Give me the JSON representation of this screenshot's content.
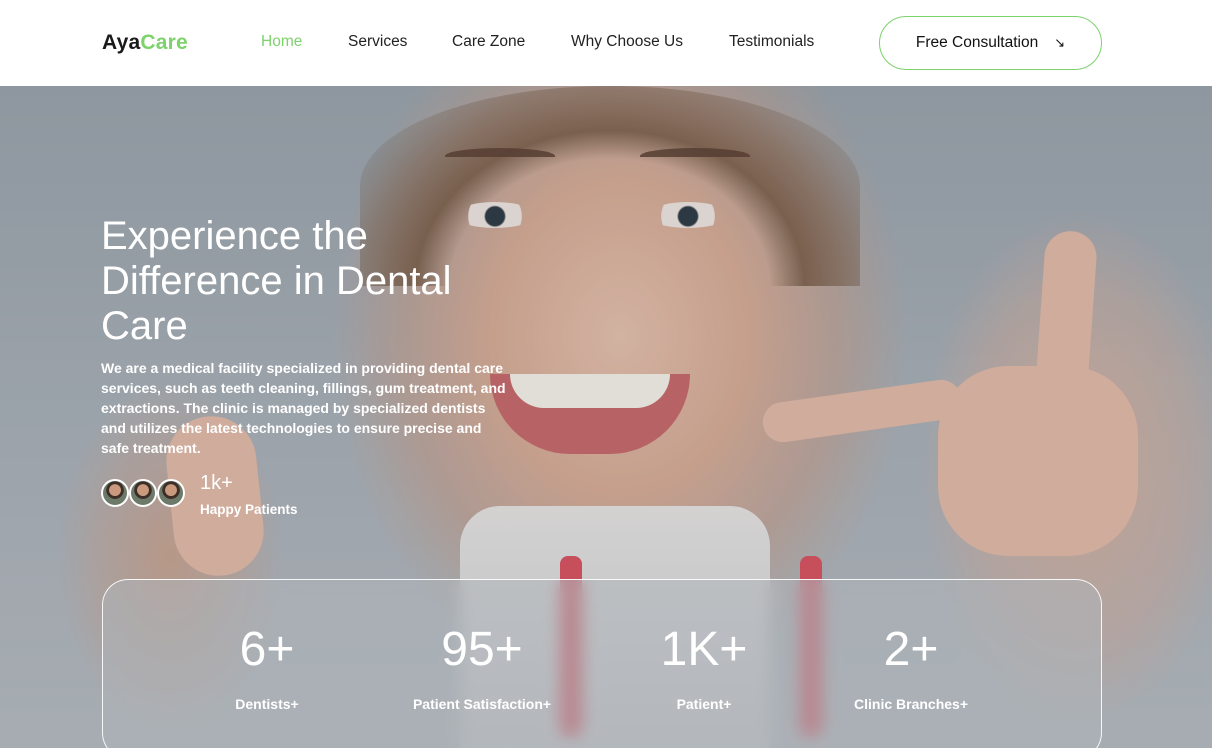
{
  "brand": {
    "part1": "Aya",
    "part2": "Care"
  },
  "nav": {
    "items": [
      {
        "label": "Home",
        "active": true
      },
      {
        "label": "Services",
        "active": false
      },
      {
        "label": "Care Zone",
        "active": false
      },
      {
        "label": "Why Choose Us",
        "active": false
      },
      {
        "label": "Testimonials",
        "active": false
      }
    ],
    "cta_label": "Free Consultation",
    "cta_icon": "arrow-down-right-icon"
  },
  "hero": {
    "title": "Experience the Difference in Dental Care",
    "description": "We are a medical facility specialized in providing dental care services, such as teeth cleaning, fillings, gum treatment, and extractions. The clinic is managed by specialized dentists and utilizes the latest technologies to ensure precise and safe treatment.",
    "patients_count": "1k+",
    "patients_label": "Happy Patients"
  },
  "stats": [
    {
      "value": "6+",
      "label": "Dentists+"
    },
    {
      "value": "95+",
      "label": "Patient Satisfaction+"
    },
    {
      "value": "1K+",
      "label": "Patient+"
    },
    {
      "value": "2+",
      "label": "Clinic Branches+"
    }
  ],
  "colors": {
    "accent": "#7dd26c",
    "text_dark": "#1a1a1a",
    "white": "#ffffff"
  }
}
